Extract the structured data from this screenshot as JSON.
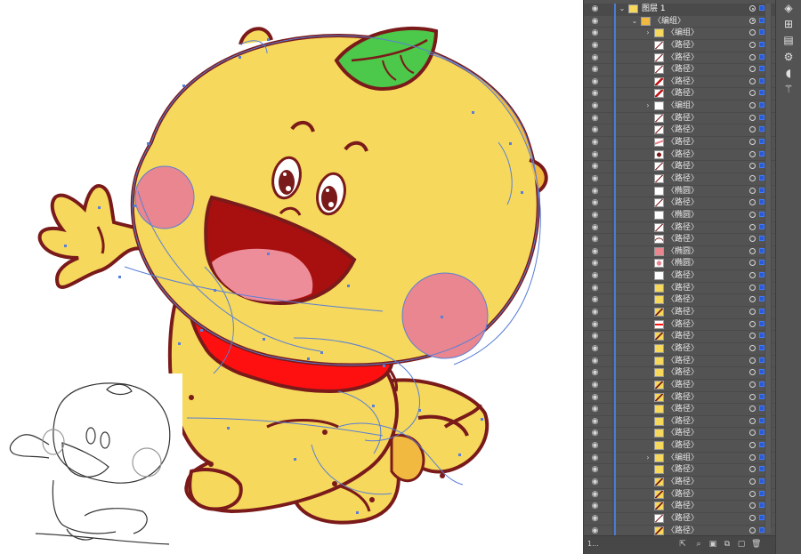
{
  "app": {
    "panel": "layers"
  },
  "colors": {
    "body_yellow": "#f5d85c",
    "shade_orange": "#f2b941",
    "outline": "#7a1a1a",
    "cheek_pink": "#e9868f",
    "mouth_dark": "#a80f0f",
    "tongue_pink": "#ee8d9a",
    "bib_red": "#ff1010",
    "leaf_green": "#4cc84a",
    "path_blue": "#5a7fd6",
    "panel_bg": "#535353"
  },
  "layers": {
    "top_layer": "图层 1",
    "group_label": "〈编组〉",
    "rows": [
      {
        "label": "〈编组〉",
        "twisty": true,
        "thumb": "group"
      },
      {
        "label": "〈路径〉",
        "thumb": "stroke"
      },
      {
        "label": "〈路径〉",
        "thumb": "stroke"
      },
      {
        "label": "〈路径〉",
        "thumb": "stroke"
      },
      {
        "label": "〈路径〉",
        "thumb": "redstroke"
      },
      {
        "label": "〈路径〉",
        "thumb": "redstroke"
      },
      {
        "label": "〈编组〉",
        "twisty": true,
        "thumb": "plain"
      },
      {
        "label": "〈路径〉",
        "thumb": "stroke"
      },
      {
        "label": "〈路径〉",
        "thumb": "stroke"
      },
      {
        "label": "〈路径〉",
        "thumb": "pinkmark"
      },
      {
        "label": "〈路径〉",
        "thumb": "darkfill"
      },
      {
        "label": "〈路径〉",
        "thumb": "stroke"
      },
      {
        "label": "〈路径〉",
        "thumb": "stroke"
      },
      {
        "label": "〈椭圆〉",
        "thumb": "plain"
      },
      {
        "label": "〈路径〉",
        "thumb": "stroke"
      },
      {
        "label": "〈椭圆〉",
        "thumb": "plain"
      },
      {
        "label": "〈路径〉",
        "thumb": "stroke"
      },
      {
        "label": "〈路径〉",
        "thumb": "arc"
      },
      {
        "label": "〈椭圆〉",
        "thumb": "pinkfill"
      },
      {
        "label": "〈椭圆〉",
        "thumb": "pinkdot"
      },
      {
        "label": "〈路径〉",
        "thumb": "plain"
      },
      {
        "label": "〈路径〉",
        "thumb": "yellow"
      },
      {
        "label": "〈路径〉",
        "thumb": "yellow"
      },
      {
        "label": "〈路径〉",
        "thumb": "yellowmark"
      },
      {
        "label": "〈路径〉",
        "thumb": "redmark"
      },
      {
        "label": "〈路径〉",
        "thumb": "yellowmark"
      },
      {
        "label": "〈路径〉",
        "thumb": "yellow"
      },
      {
        "label": "〈路径〉",
        "thumb": "yellow"
      },
      {
        "label": "〈路径〉",
        "thumb": "yellow"
      },
      {
        "label": "〈路径〉",
        "thumb": "yellowmark"
      },
      {
        "label": "〈路径〉",
        "thumb": "yellowmark"
      },
      {
        "label": "〈路径〉",
        "thumb": "yellow"
      },
      {
        "label": "〈路径〉",
        "thumb": "yellow"
      },
      {
        "label": "〈路径〉",
        "thumb": "yellow"
      },
      {
        "label": "〈路径〉",
        "thumb": "yellow"
      },
      {
        "label": "〈编组〉",
        "twisty": true,
        "thumb": "yellow"
      },
      {
        "label": "〈路径〉",
        "thumb": "yellow"
      },
      {
        "label": "〈路径〉",
        "thumb": "yellowmark"
      },
      {
        "label": "〈路径〉",
        "thumb": "yellowmark"
      },
      {
        "label": "〈路径〉",
        "thumb": "yellowmark"
      },
      {
        "label": "〈路径〉",
        "thumb": "stroke"
      },
      {
        "label": "〈路径〉",
        "thumb": "yellowmark"
      }
    ],
    "footer_count": "1..."
  },
  "toolstrip": {
    "icons": [
      "layers-panel-icon",
      "artboards-icon",
      "document-icon",
      "links-icon",
      "curve-icon",
      "magic-wand-icon"
    ]
  }
}
